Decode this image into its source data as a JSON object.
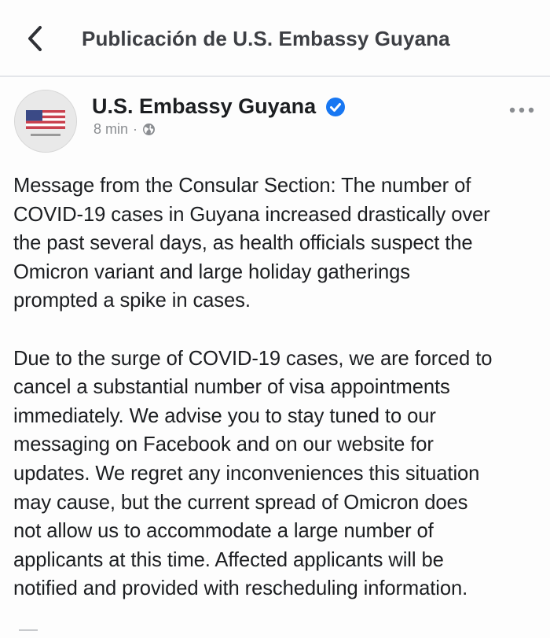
{
  "header": {
    "title": "Publicación de U.S. Embassy Guyana",
    "back_icon": "chevron-left-icon"
  },
  "post": {
    "page_name": "U.S. Embassy Guyana",
    "verified_icon": "verified-badge-icon",
    "time": "8 min",
    "separator": "·",
    "audience_icon": "globe-icon",
    "more_icon": "more-horizontal-icon",
    "avatar": "us-flag-avatar",
    "paragraphs": [
      "Message from the Consular Section: The number of\nCOVID-19 cases in Guyana increased drastically over\nthe past several days, as health officials suspect the\nOmicron variant and large holiday gatherings\nprompted a spike in cases.",
      "Due to the surge of COVID-19 cases, we are forced to\ncancel a substantial number of visa appointments\nimmediately. We advise you to stay tuned to our\nmessaging on Facebook and on our website for\nupdates. We regret any inconveniences this situation\nmay cause, but the current spread of Omicron does\nnot allow us to accommodate a large number of\napplicants at this time. Affected applicants will be\nnotified and provided with rescheduling information."
    ]
  },
  "colors": {
    "verified_blue": "#1877f2",
    "text": "#1c1e21",
    "secondary_text": "#8a8d91",
    "header_text": "#3d3f44"
  }
}
